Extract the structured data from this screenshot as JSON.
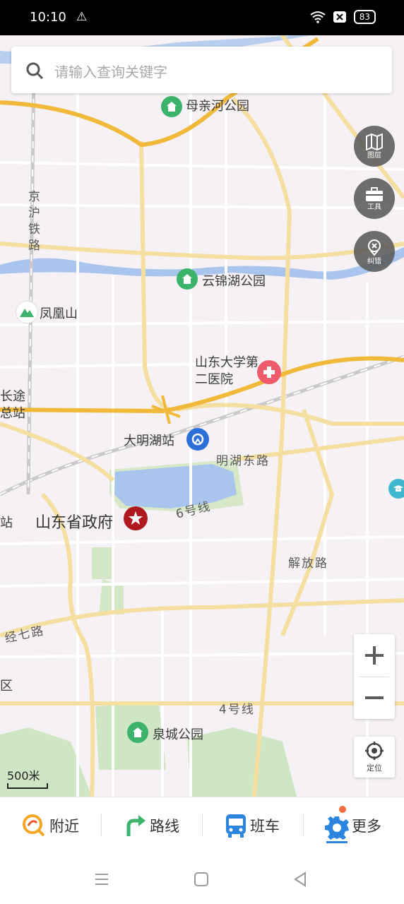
{
  "status_bar": {
    "time": "10:10",
    "warning_icon": "warning-icon",
    "wifi_icon": "wifi-icon",
    "battery_level": "83"
  },
  "search": {
    "placeholder": "请输入查询关键字"
  },
  "map_labels": {
    "muqinhe_park": "母亲河公园",
    "jinghu_railway": "京沪铁路",
    "yunjinhu_park": "云锦湖公园",
    "fenghuangshan": "凤凰山",
    "shandong_univ_hospital": "山东大学第二医院",
    "changtu": "长途总站",
    "daminghu_station": "大明湖站",
    "minghu_east_road": "明湖东路",
    "provincial_gov": "山东省政府",
    "line6": "6号线",
    "jiefang_road": "解放路",
    "jingqi_road": "经七路",
    "district": "区",
    "line4": "4号线",
    "quancheng_park": "泉城公园",
    "edge_zhan": "站"
  },
  "side_buttons": {
    "layers": "图层",
    "tools": "工具",
    "correct": "纠错"
  },
  "locate_label": "定位",
  "scale_label": "500米",
  "tabs": {
    "nearby": "附近",
    "route": "路线",
    "bus": "班车",
    "more": "更多"
  },
  "colors": {
    "park_green": "#3cb36b",
    "hospital_red": "#ee5b6c",
    "metro_blue": "#2d6fd9",
    "gov_red": "#b0181f",
    "major_road": "#f6c24c",
    "river": "#a9c5ee",
    "accent_orange": "#f5a623",
    "more_blue": "#2c86e0"
  }
}
